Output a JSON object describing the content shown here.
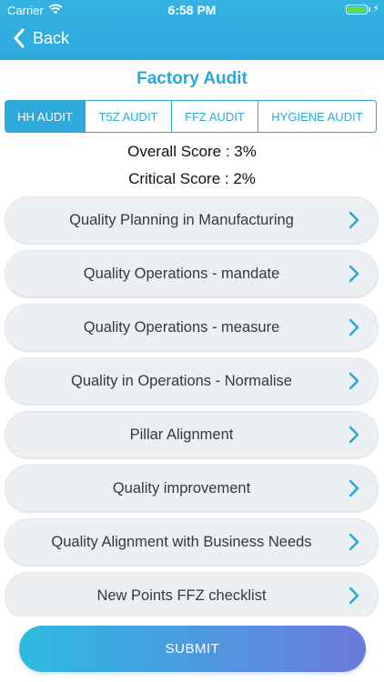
{
  "status_bar": {
    "carrier": "Carrier",
    "time": "6:58 PM"
  },
  "nav": {
    "back_label": "Back"
  },
  "page_title": "Factory Audit",
  "tabs": [
    {
      "label": "HH AUDIT",
      "active": true
    },
    {
      "label": "T5Z AUDIT",
      "active": false
    },
    {
      "label": "FFZ AUDIT",
      "active": false
    },
    {
      "label": "HYGIENE AUDIT",
      "active": false
    }
  ],
  "scores": {
    "overall": "Overall Score : 3%",
    "critical": "Critical Score : 2%"
  },
  "sections": [
    {
      "label": "Quality Planning in Manufacturing"
    },
    {
      "label": "Quality Operations - mandate"
    },
    {
      "label": "Quality Operations - measure"
    },
    {
      "label": "Quality in Operations - Normalise"
    },
    {
      "label": "Pillar Alignment"
    },
    {
      "label": "Quality improvement"
    },
    {
      "label": "Quality Alignment with Business Needs"
    },
    {
      "label": "New Points FFZ checklist"
    }
  ],
  "submit_label": "SUBMIT",
  "colors": {
    "accent": "#2ea9dc",
    "item_bg": "#edf0f3",
    "chevron": "#2ba7dc"
  }
}
